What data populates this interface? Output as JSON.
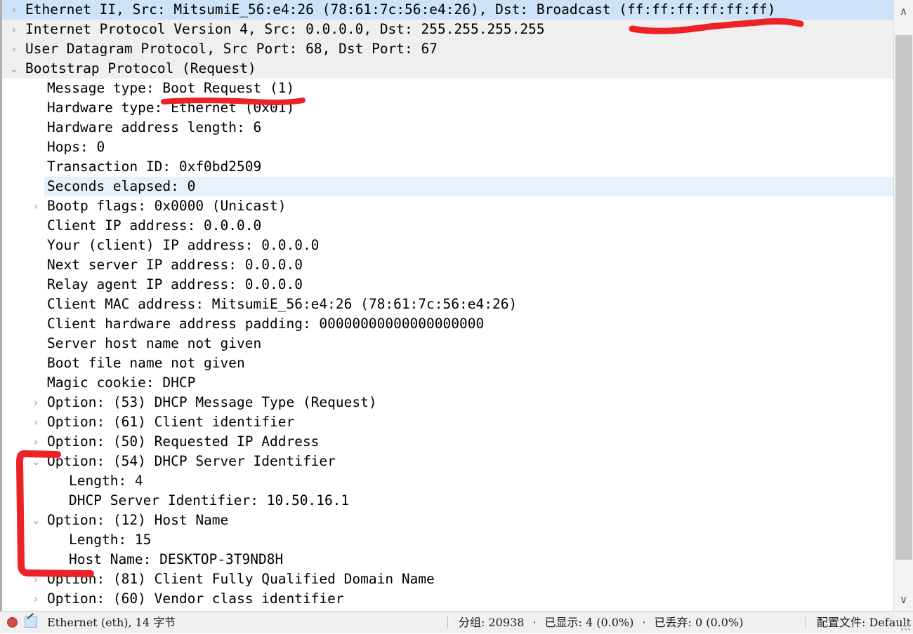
{
  "window": {
    "app": "wireshark-packet-details"
  },
  "detail_tree": {
    "rows": [
      {
        "level": 0,
        "chevron": "collapsed",
        "text": "Ethernet II, Src: MitsumiE_56:e4:26 (78:61:7c:56:e4:26), Dst: Broadcast (ff:ff:ff:ff:ff:ff)",
        "bg": "selected",
        "name": "tree-row-ethernet-ii"
      },
      {
        "level": 0,
        "chevron": "collapsed",
        "text": "Internet Protocol Version 4, Src: 0.0.0.0, Dst: 255.255.255.255",
        "bg": "gray",
        "name": "tree-row-ipv4"
      },
      {
        "level": 0,
        "chevron": "collapsed",
        "text": "User Datagram Protocol, Src Port: 68, Dst Port: 67",
        "bg": "gray",
        "name": "tree-row-udp"
      },
      {
        "level": 0,
        "chevron": "expanded",
        "text": "Bootstrap Protocol (Request)",
        "bg": "gray",
        "name": "tree-row-bootp"
      },
      {
        "level": 1,
        "chevron": "none",
        "text": "Message type: Boot Request (1)",
        "bg": "white",
        "name": "tree-row-message-type"
      },
      {
        "level": 1,
        "chevron": "none",
        "text": "Hardware type: Ethernet (0x01)",
        "bg": "white",
        "name": "tree-row-hardware-type"
      },
      {
        "level": 1,
        "chevron": "none",
        "text": "Hardware address length: 6",
        "bg": "white",
        "name": "tree-row-hardware-address-length"
      },
      {
        "level": 1,
        "chevron": "none",
        "text": "Hops: 0",
        "bg": "white",
        "name": "tree-row-hops"
      },
      {
        "level": 1,
        "chevron": "none",
        "text": "Transaction ID: 0xf0bd2509",
        "bg": "white",
        "name": "tree-row-transaction-id"
      },
      {
        "level": 1,
        "chevron": "none",
        "text": "Seconds elapsed: 0",
        "bg": "soft-highlight",
        "name": "tree-row-seconds-elapsed"
      },
      {
        "level": 1,
        "chevron": "collapsed",
        "text": "Bootp flags: 0x0000 (Unicast)",
        "bg": "white",
        "name": "tree-row-bootp-flags"
      },
      {
        "level": 1,
        "chevron": "none",
        "text": "Client IP address: 0.0.0.0",
        "bg": "white",
        "name": "tree-row-client-ip-address"
      },
      {
        "level": 1,
        "chevron": "none",
        "text": "Your (client) IP address: 0.0.0.0",
        "bg": "white",
        "name": "tree-row-your-client-ip-address"
      },
      {
        "level": 1,
        "chevron": "none",
        "text": "Next server IP address: 0.0.0.0",
        "bg": "white",
        "name": "tree-row-next-server-ip-address"
      },
      {
        "level": 1,
        "chevron": "none",
        "text": "Relay agent IP address: 0.0.0.0",
        "bg": "white",
        "name": "tree-row-relay-agent-ip-address"
      },
      {
        "level": 1,
        "chevron": "none",
        "text": "Client MAC address: MitsumiE_56:e4:26 (78:61:7c:56:e4:26)",
        "bg": "white",
        "name": "tree-row-client-mac-address"
      },
      {
        "level": 1,
        "chevron": "none",
        "text": "Client hardware address padding: 00000000000000000000",
        "bg": "white",
        "name": "tree-row-client-hardware-address-padding"
      },
      {
        "level": 1,
        "chevron": "none",
        "text": "Server host name not given",
        "bg": "white",
        "name": "tree-row-server-host-name"
      },
      {
        "level": 1,
        "chevron": "none",
        "text": "Boot file name not given",
        "bg": "white",
        "name": "tree-row-boot-file-name"
      },
      {
        "level": 1,
        "chevron": "none",
        "text": "Magic cookie: DHCP",
        "bg": "white",
        "name": "tree-row-magic-cookie"
      },
      {
        "level": 1,
        "chevron": "collapsed",
        "text": "Option: (53) DHCP Message Type (Request)",
        "bg": "white",
        "name": "tree-row-option-53"
      },
      {
        "level": 1,
        "chevron": "collapsed",
        "text": "Option: (61) Client identifier",
        "bg": "white",
        "name": "tree-row-option-61"
      },
      {
        "level": 1,
        "chevron": "collapsed",
        "text": "Option: (50) Requested IP Address",
        "bg": "white",
        "name": "tree-row-option-50"
      },
      {
        "level": 1,
        "chevron": "expanded",
        "text": "Option: (54) DHCP Server Identifier",
        "bg": "white",
        "name": "tree-row-option-54"
      },
      {
        "level": 2,
        "chevron": "none",
        "text": "Length: 4",
        "bg": "white",
        "name": "tree-row-option-54-length"
      },
      {
        "level": 2,
        "chevron": "none",
        "text": "DHCP Server Identifier: 10.50.16.1",
        "bg": "white",
        "name": "tree-row-dhcp-server-identifier-value"
      },
      {
        "level": 1,
        "chevron": "expanded",
        "text": "Option: (12) Host Name",
        "bg": "white",
        "name": "tree-row-option-12"
      },
      {
        "level": 2,
        "chevron": "none",
        "text": "Length: 15",
        "bg": "white",
        "name": "tree-row-option-12-length"
      },
      {
        "level": 2,
        "chevron": "none",
        "text": "Host Name: DESKTOP-3T9ND8H",
        "bg": "white",
        "name": "tree-row-host-name-value"
      },
      {
        "level": 1,
        "chevron": "collapsed",
        "text": "Option: (81) Client Fully Qualified Domain Name",
        "bg": "white",
        "name": "tree-row-option-81"
      },
      {
        "level": 1,
        "chevron": "collapsed",
        "text": "Option: (60) Vendor class identifier",
        "bg": "white",
        "name": "tree-row-option-60"
      }
    ],
    "chevron_glyphs": {
      "collapsed": "›",
      "expanded": "⌄",
      "none": ""
    }
  },
  "scrollbar": {
    "up_arrow": "∧",
    "down_arrow": "∨"
  },
  "statusbar": {
    "capture_interface": "Ethernet (eth), 14 字节",
    "packets_label": "分组: 20938",
    "displayed_label": "已显示: 4 (0.0%)",
    "dropped_label": "已丢弃: 0 (0.0%)",
    "profile_label": "配置文件: Default",
    "dot": "·"
  },
  "annotations": {
    "color": "#ec2227",
    "items": [
      {
        "name": "annotation-squiggle-ipv4-dst",
        "kind": "squiggle"
      },
      {
        "name": "annotation-underline-boot-request",
        "kind": "underline"
      },
      {
        "name": "annotation-bracket-dhcp-options",
        "kind": "bracket"
      }
    ]
  }
}
